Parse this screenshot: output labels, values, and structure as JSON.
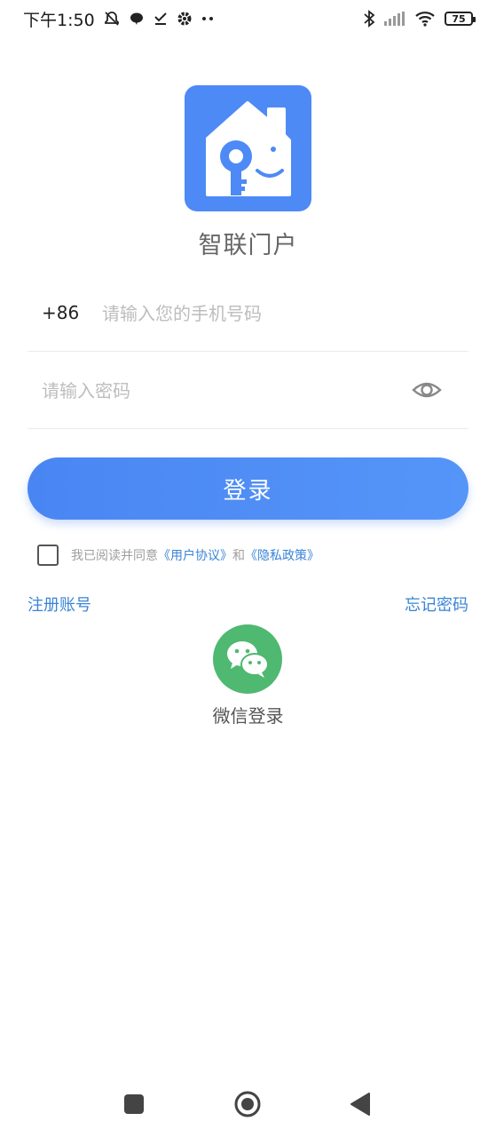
{
  "status_bar": {
    "time": "下午1:50",
    "icons": [
      "mute-icon",
      "chat-bubble-icon",
      "checklist-icon",
      "settings-icon",
      "more-dots-icon",
      "bluetooth-icon",
      "signal-icon",
      "wifi-icon"
    ],
    "battery": "75"
  },
  "app": {
    "name": "智联门户",
    "logo_color": "#4e8af5"
  },
  "form": {
    "country_code": "+86",
    "phone_placeholder": "请输入您的手机号码",
    "phone_value": "",
    "password_placeholder": "请输入密码",
    "password_value": ""
  },
  "login_button": {
    "label": "登录",
    "color": "#4a86f3"
  },
  "agreement": {
    "prefix": "我已阅读并同意",
    "user_agreement": "《用户协议》",
    "and": "和",
    "privacy_policy": "《隐私政策》",
    "checked": false
  },
  "links": {
    "register": "注册账号",
    "forgot_password": "忘记密码"
  },
  "wechat": {
    "label": "微信登录",
    "color": "#4fb871"
  },
  "nav_bar": {
    "icons": [
      "recent-apps-icon",
      "home-icon",
      "back-icon"
    ]
  }
}
